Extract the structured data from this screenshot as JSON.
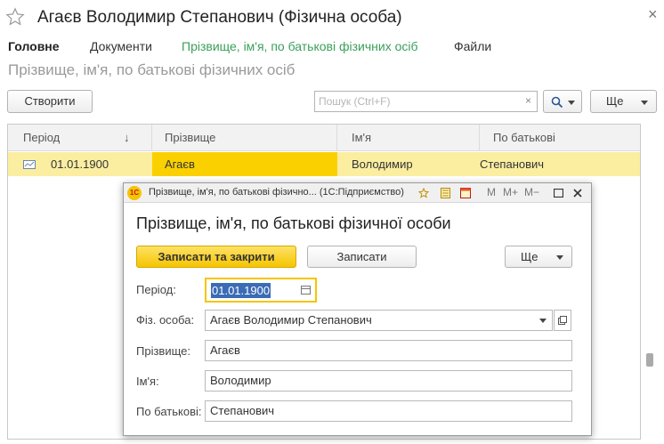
{
  "window": {
    "title": "Агаєв Володимир Степанович (Фізична особа)",
    "close_glyph": "×"
  },
  "tabs": [
    {
      "label": "Головне"
    },
    {
      "label": "Документи"
    },
    {
      "label": "Прізвище, ім'я, по батькові фізичних осіб"
    },
    {
      "label": "Файли"
    }
  ],
  "section_title": "Прізвище, ім'я, по батькові фізичних осіб",
  "toolbar": {
    "create_label": "Створити",
    "search_placeholder": "Пошук (Ctrl+F)",
    "clear_glyph": "×",
    "more_label": "Ще"
  },
  "table": {
    "columns": [
      "Період",
      "Прізвище",
      "Ім'я",
      "По батькові"
    ],
    "sort_glyph": "↓",
    "rows": [
      {
        "period": "01.01.1900",
        "surname": "Агаєв",
        "name": "Володимир",
        "patronymic": "Степанович"
      }
    ]
  },
  "modal": {
    "window_title": "Прізвище, ім'я, по батькові фізично... (1С:Підприємство)",
    "logo_text": "1С",
    "heading": "Прізвище, ім'я, по батькові фізичної особи",
    "save_close_label": "Записати та закрити",
    "save_label": "Записати",
    "more_label": "Ще",
    "fields": {
      "period": {
        "label": "Період:",
        "value": "01.01.1900"
      },
      "person": {
        "label": "Фіз. особа:",
        "value": "Агаєв Володимир Степанович"
      },
      "surname": {
        "label": "Прізвище:",
        "value": "Агаєв"
      },
      "name": {
        "label": "Ім'я:",
        "value": "Володимир"
      },
      "patronymic": {
        "label": "По батькові:",
        "value": "Степанович"
      }
    },
    "toolbar_icons": {
      "m": "M",
      "m_plus": "M+",
      "m_minus": "M−"
    }
  },
  "icons": [
    "star-icon",
    "close-icon",
    "search-icon",
    "chevron-down-icon",
    "calendar-icon",
    "open-icon",
    "maximize-icon"
  ]
}
